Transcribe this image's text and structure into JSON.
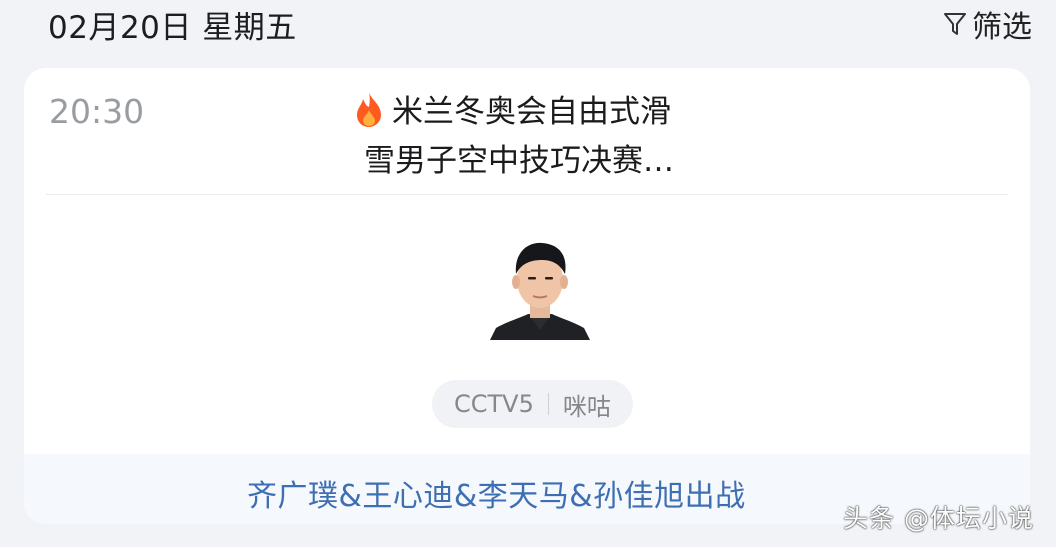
{
  "header": {
    "date": "02月20日 星期五",
    "filter_label": "筛选"
  },
  "event": {
    "time": "20:30",
    "title_line1": "米兰冬奥会自由式滑",
    "title_line2": "雪男子空中技巧决赛…",
    "channels": [
      "CCTV5",
      "咪咕"
    ],
    "players": "齐广璞&王心迪&李天马&孙佳旭出战"
  },
  "watermark": "头条 @体坛小说",
  "colors": {
    "background": "#f2f3f7",
    "card": "#ffffff",
    "players_text": "#3f6fb3",
    "flame": "#ff5a1f"
  },
  "icons": [
    "filter-icon",
    "flame-icon",
    "athlete-avatar"
  ]
}
